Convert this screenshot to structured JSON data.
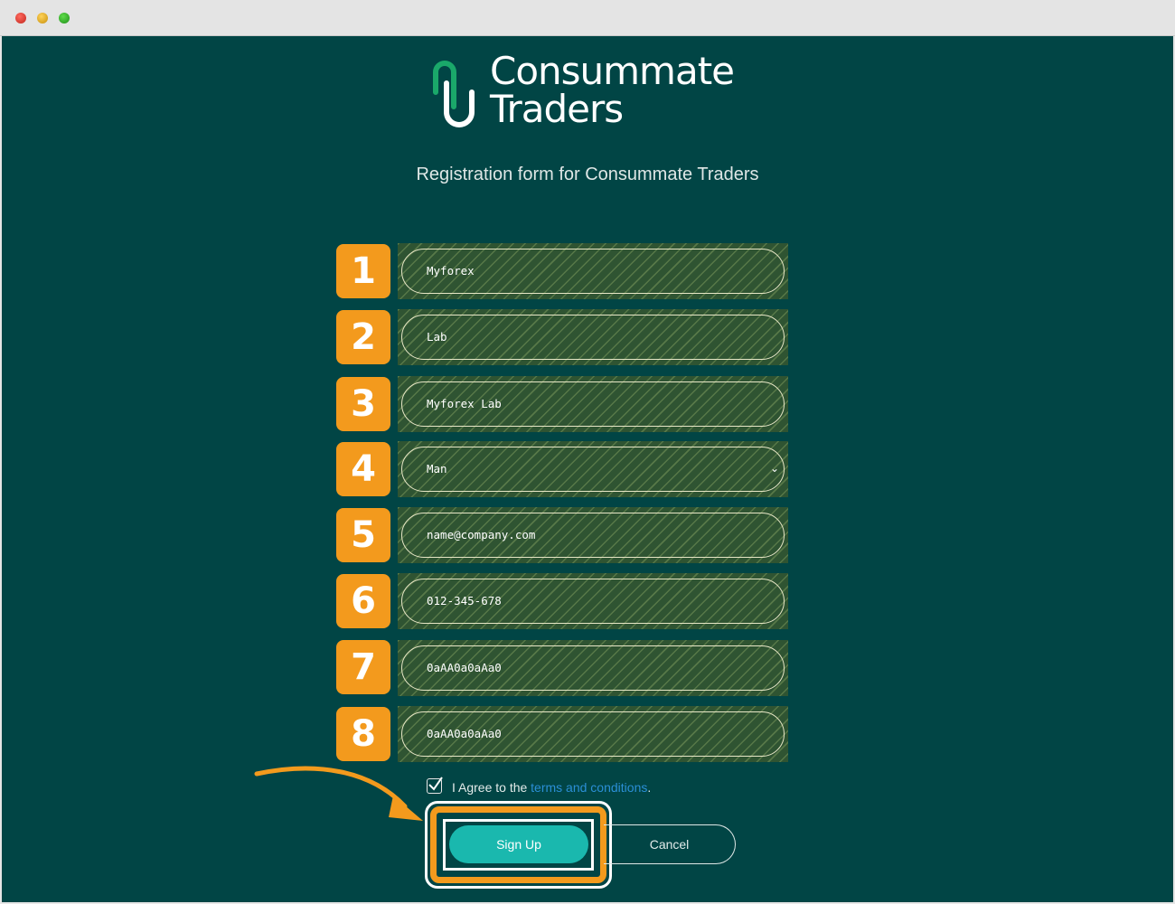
{
  "window": {
    "controls": [
      "close-dot",
      "minimize-dot",
      "maximize-dot"
    ]
  },
  "logo": {
    "line1": "Consummate",
    "line2": "Traders"
  },
  "subtitle": "Registration form for Consummate Traders",
  "fields": [
    {
      "step": "1",
      "value": "Myforex"
    },
    {
      "step": "2",
      "value": "Lab"
    },
    {
      "step": "3",
      "value": "Myforex Lab"
    },
    {
      "step": "4",
      "value": "Man"
    },
    {
      "step": "5",
      "value": "name@company.com"
    },
    {
      "step": "6",
      "value": "012-345-678"
    },
    {
      "step": "7",
      "value": "0aAA0a0aAa0"
    },
    {
      "step": "8",
      "value": "0aAA0a0aAa0"
    }
  ],
  "agree": {
    "prefix": "I Agree to the ",
    "link": "terms and conditions",
    "suffix": ".",
    "checked": true
  },
  "buttons": {
    "signup": "Sign Up",
    "cancel": "Cancel"
  },
  "colors": {
    "background": "#014545",
    "accent": "#f39a1d",
    "primary_button": "#1ab8ae",
    "link": "#2b8fd6",
    "logo_green": "#1aa86a"
  }
}
